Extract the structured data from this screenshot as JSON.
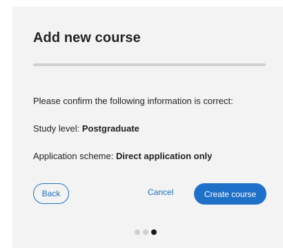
{
  "dialog": {
    "title": "Add new course",
    "progress_percent": 100,
    "confirm_text": "Please confirm the following information is correct:",
    "study_level_label": "Study level:",
    "study_level_value": "Postgraduate",
    "application_scheme_label": "Application scheme:",
    "application_scheme_value": "Direct application only"
  },
  "buttons": {
    "back_label": "Back",
    "cancel_label": "Cancel",
    "create_label": "Create course"
  },
  "steps": {
    "total": 3,
    "current": 3
  },
  "colors": {
    "accent": "#1f70c8",
    "panel": "#f3f3f3",
    "progress_track": "#dddddd",
    "dot_inactive": "#cfcfcf",
    "dot_active": "#1a1a1a"
  }
}
